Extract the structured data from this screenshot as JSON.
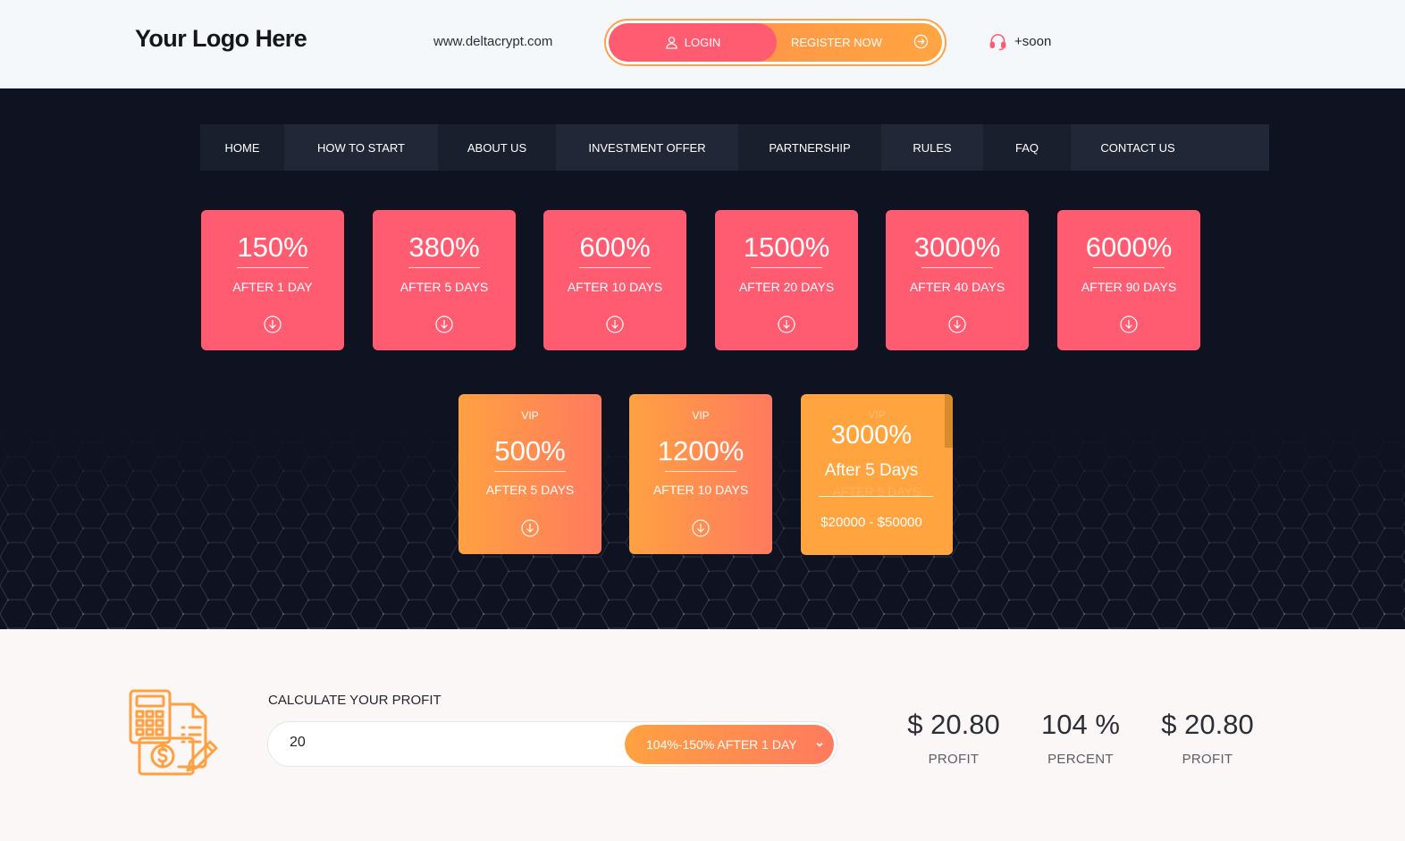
{
  "header": {
    "logo": "Your Logo Here",
    "url": "www.deltacrypt.com",
    "login_label": "LOGIN",
    "register_label": "REGISTER NOW",
    "support_label": "+soon"
  },
  "nav": [
    {
      "label": "HOME"
    },
    {
      "label": "HOW TO START"
    },
    {
      "label": "ABOUT US"
    },
    {
      "label": "INVESTMENT OFFER"
    },
    {
      "label": "PARTNERSHIP"
    },
    {
      "label": "RULES"
    },
    {
      "label": "FAQ"
    },
    {
      "label": "CONTACT US"
    }
  ],
  "plans": [
    {
      "percent": "150%",
      "period": "AFTER 1 DAY"
    },
    {
      "percent": "380%",
      "period": "AFTER 5 DAYS"
    },
    {
      "percent": "600%",
      "period": "AFTER 10 DAYS"
    },
    {
      "percent": "1500%",
      "period": "AFTER 20 DAYS"
    },
    {
      "percent": "3000%",
      "period": "AFTER 40 DAYS"
    },
    {
      "percent": "6000%",
      "period": "AFTER 90 DAYS"
    }
  ],
  "vip_plans": [
    {
      "tag": "VIP",
      "percent": "500%",
      "period": "AFTER 5 DAYS"
    },
    {
      "tag": "VIP",
      "percent": "1200%",
      "period": "AFTER 10 DAYS"
    },
    {
      "tag": "VIP",
      "percent": "3000%",
      "period": "After 5 Days",
      "range": "$20000 - $50000"
    }
  ],
  "calculator": {
    "label": "CALCULATE YOUR PROFIT",
    "amount_value": "20",
    "plan_selected": "104%-150% AFTER 1 DAY"
  },
  "stats": [
    {
      "value": "$ 20.80",
      "caption": "PROFIT"
    },
    {
      "value": "104 %",
      "caption": "PERCENT"
    },
    {
      "value": "$ 20.80",
      "caption": "PROFIT"
    }
  ],
  "colors": {
    "pink": "#ff5b71",
    "orange": "#ffa142",
    "dark_bg": "#0e1221",
    "nav_bg": "#1a1f2d"
  },
  "icons": {
    "login": "user-icon",
    "register": "arrow-circle-right-icon",
    "support": "headset-icon",
    "plan": "arrow-down-circle-icon",
    "calculator": "calculator-invoice-icon",
    "select": "chevron-down-icon"
  }
}
